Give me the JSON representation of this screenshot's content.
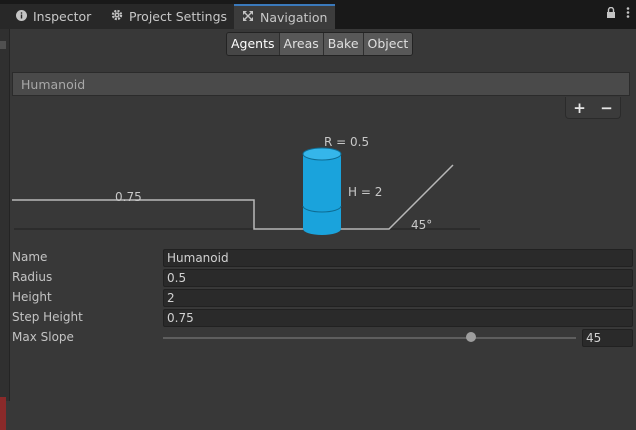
{
  "tabs": {
    "inspector": "Inspector",
    "project_settings": "Project Settings",
    "navigation": "Navigation"
  },
  "toolbar": {
    "agents": "Agents",
    "areas": "Areas",
    "bake": "Bake",
    "object": "Object"
  },
  "agent_list": {
    "items": [
      "Humanoid"
    ],
    "add": "+",
    "remove": "−"
  },
  "diagram": {
    "radius_label": "R = 0.5",
    "height_label": "H = 2",
    "step_label": "0.75",
    "slope_label": "45°",
    "cylinder_color": "#1aa3dc"
  },
  "form": {
    "name_label": "Name",
    "name_value": "Humanoid",
    "radius_label": "Radius",
    "radius_value": "0.5",
    "height_label": "Height",
    "height_value": "2",
    "step_height_label": "Step Height",
    "step_height_value": "0.75",
    "max_slope_label": "Max Slope",
    "max_slope_value": "45"
  }
}
